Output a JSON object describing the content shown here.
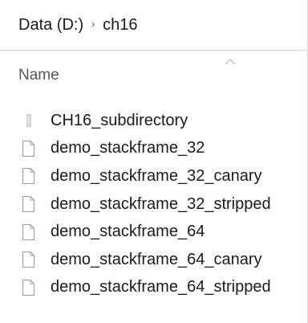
{
  "breadcrumb": {
    "drive": "Data (D:)",
    "separator": "›",
    "folder": "ch16"
  },
  "columns": {
    "name": "Name"
  },
  "items": [
    {
      "label": "CH16_subdirectory",
      "type": "folder"
    },
    {
      "label": "demo_stackframe_32",
      "type": "file"
    },
    {
      "label": "demo_stackframe_32_canary",
      "type": "file"
    },
    {
      "label": "demo_stackframe_32_stripped",
      "type": "file"
    },
    {
      "label": "demo_stackframe_64",
      "type": "file"
    },
    {
      "label": "demo_stackframe_64_canary",
      "type": "file"
    },
    {
      "label": "demo_stackframe_64_stripped",
      "type": "file"
    }
  ],
  "colors": {
    "text": "#1a1a1a",
    "header_text": "#555555",
    "divider": "#d9d9d9",
    "icon_border": "#9a9a9a",
    "folder_icon": "#d0d0d0"
  }
}
